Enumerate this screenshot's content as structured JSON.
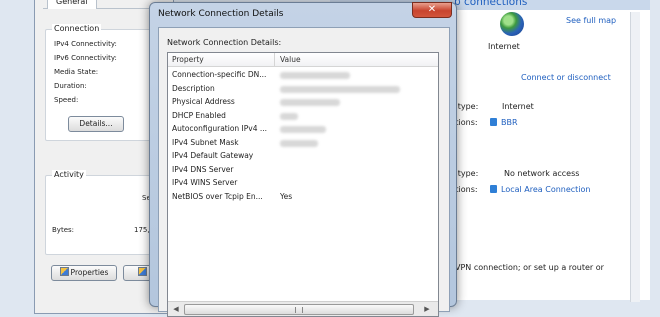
{
  "status_window": {
    "tab": "General",
    "connection_group": "Connection",
    "ipv4_label": "IPv4 Connectivity:",
    "ipv6_label": "IPv6 Connectivity:",
    "media_label": "Media State:",
    "duration_label": "Duration:",
    "speed_label": "Speed:",
    "details_button": "Details...",
    "activity_group": "Activity",
    "sent_fragment": "Se",
    "bytes_label": "Bytes:",
    "bytes_value": "175,",
    "properties_button": "Properties"
  },
  "nsc": {
    "heading": "p connections",
    "see_full_map": "See full map",
    "internet_label": "Internet",
    "connect_disconnect": "Connect or disconnect",
    "access_type_label_1": "s type:",
    "access_type_value_1": "Internet",
    "connections_label_1": "ctions:",
    "connections_value_1": "BBR",
    "access_type_label_2": "s type:",
    "access_type_value_2": "No network access",
    "connections_label_2": "ctions:",
    "connections_value_2": "Local Area Connection",
    "vpn_text": "VPN connection; or set up a router or"
  },
  "dialog": {
    "title": "Network Connection Details",
    "close_symbol": "✕",
    "section_label": "Network Connection Details:",
    "columns": [
      "Property",
      "Value"
    ],
    "rows": [
      {
        "property": "Connection-specific DN...",
        "value": ""
      },
      {
        "property": "Description",
        "value": ""
      },
      {
        "property": "Physical Address",
        "value": ""
      },
      {
        "property": "DHCP Enabled",
        "value": ""
      },
      {
        "property": "Autoconfiguration IPv4 ...",
        "value": ""
      },
      {
        "property": "IPv4 Subnet Mask",
        "value": ""
      },
      {
        "property": "IPv4 Default Gateway",
        "value": ""
      },
      {
        "property": "IPv4 DNS Server",
        "value": ""
      },
      {
        "property": "IPv4 WINS Server",
        "value": ""
      },
      {
        "property": "NetBIOS over Tcpip En...",
        "value": "Yes"
      }
    ],
    "scroll_left": "◀",
    "scroll_right": "▶"
  }
}
